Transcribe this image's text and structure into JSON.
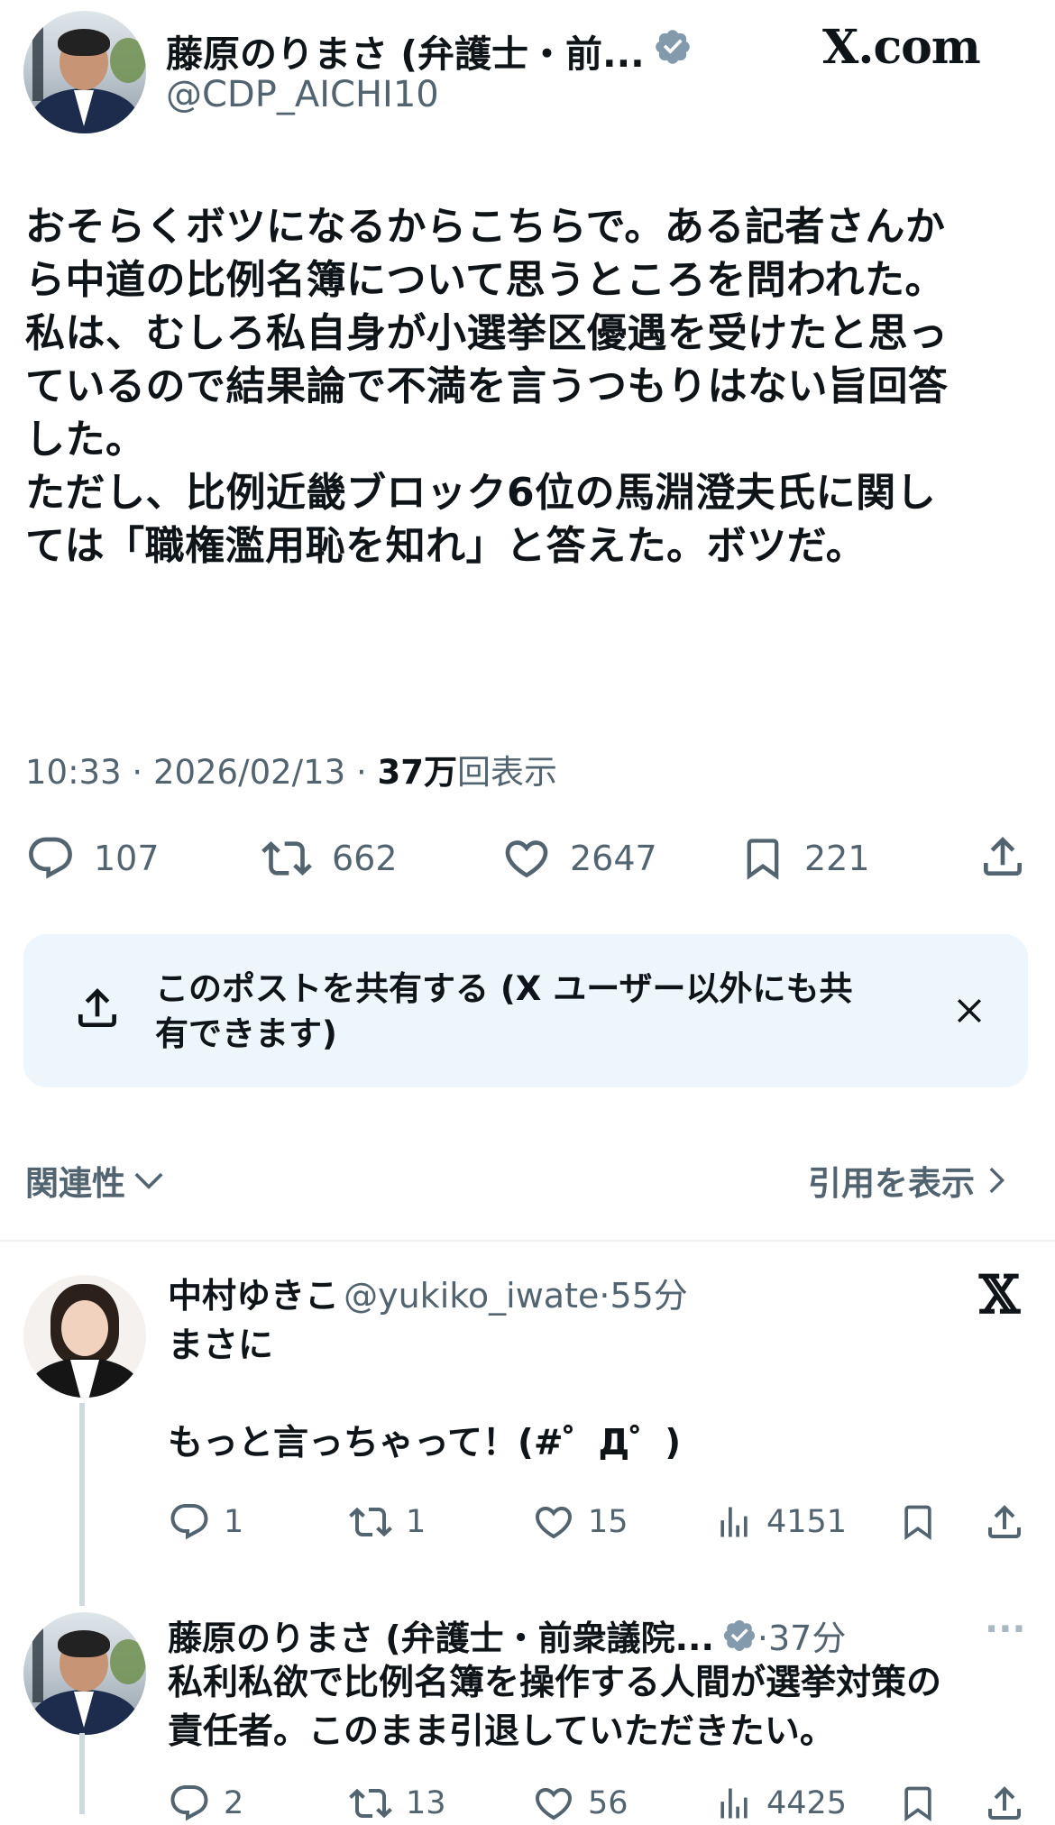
{
  "header": {
    "display_name": "藤原のりまさ (弁護士・前...",
    "handle": "@CDP_AICHI10",
    "brand": "X.com"
  },
  "post": {
    "text_lines": [
      "おそらくボツになるからこちらで。ある記者さんか",
      "ら中道の比例名簿について思うところを問われた。",
      "私は、むしろ私自身が小選挙区優遇を受けたと思っ",
      "ているので結果論で不満を言うつもりはない旨回答",
      "した。",
      "ただし、比例近畿ブロック6位の馬淵澄夫氏に関し",
      "ては「職権濫用恥を知れ」と答えた。ボツだ。"
    ],
    "time": "10:33",
    "date": "2026/02/13",
    "views_count": "37万",
    "views_label": "回表示",
    "separator": "·"
  },
  "actions": {
    "reply_count": "107",
    "repost_count": "662",
    "like_count": "2647",
    "bookmark_count": "221"
  },
  "share_banner": {
    "line1": "このポストを共有する (X ユーザー以外にも共",
    "line2": "有できます)"
  },
  "sort": {
    "label": "関連性",
    "quotes_link": "引用を表示"
  },
  "replies": [
    {
      "name": "中村ゆきこ",
      "handle": "@yukiko_iwate",
      "time": "·55分",
      "text_lines": [
        "まさに",
        "",
        "もっと言っちゃって！(#゜Д゜)"
      ],
      "reply_count": "1",
      "repost_count": "1",
      "like_count": "15",
      "view_count": "4151"
    },
    {
      "name": "藤原のりまさ (弁護士・前衆議院...",
      "time": "·37分",
      "more": "···",
      "text_lines": [
        "私利私欲で比例名簿を操作する人間が選挙対策の",
        "責任者。このまま引退していただきたい。"
      ],
      "reply_count": "2",
      "repost_count": "13",
      "like_count": "56",
      "view_count": "4425"
    }
  ],
  "colors": {
    "text": "#0f1419",
    "secondary": "#536471",
    "verified": "#829aab",
    "banner_bg": "#eef6fd",
    "divider": "#eff3f4"
  }
}
